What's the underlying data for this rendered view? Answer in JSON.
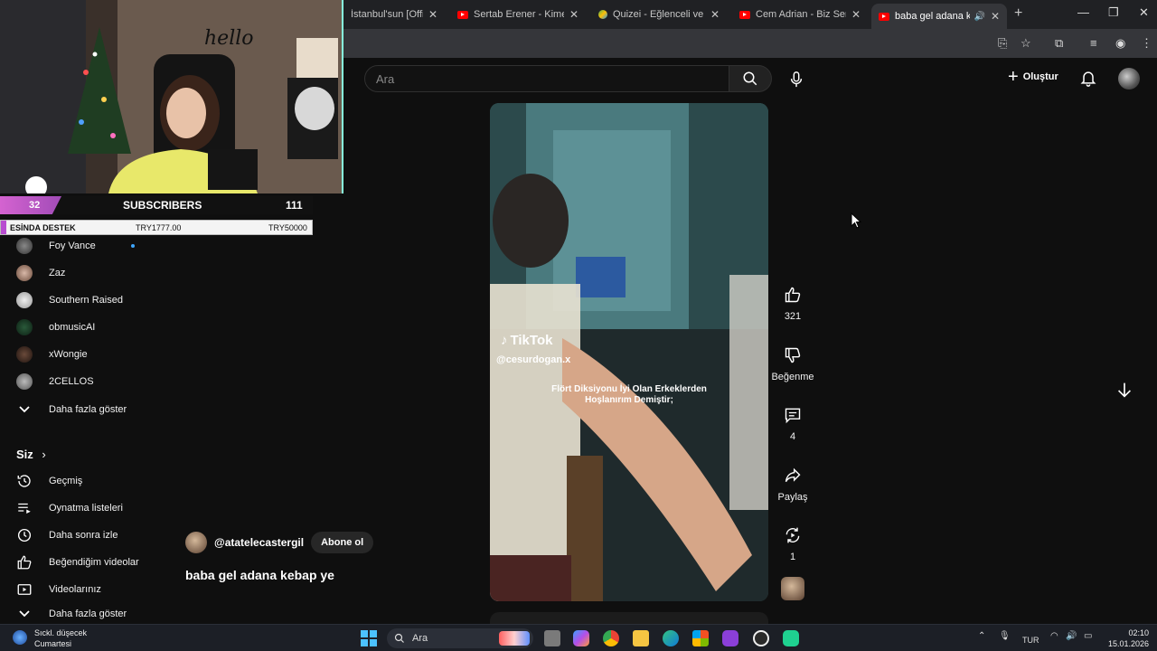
{
  "browser": {
    "tabs": [
      {
        "title": "İstanbul'sun [Official",
        "favicon": "youtube-icon"
      },
      {
        "title": "Sertab Erener - Kime Diye",
        "favicon": "youtube-icon"
      },
      {
        "title": "Quizei - Eğlenceli ve etki",
        "favicon": "quiz-icon"
      },
      {
        "title": "Cem Adrian - Biz Senle (",
        "favicon": "youtube-icon"
      },
      {
        "title": "baba gel adana kebap",
        "favicon": "youtube-icon",
        "active": true
      }
    ]
  },
  "youtube": {
    "search_placeholder": "Ara",
    "create_label": "Oluştur"
  },
  "stream_overlay": {
    "subscriber_count": "32",
    "subscribers_label": "SUBSCRIBERS",
    "subscribers_total": "111",
    "goal_label": "ESİNDA DESTEK",
    "goal_current": "TRY1777.00",
    "goal_target": "TRY50000",
    "webcam_text": "hello"
  },
  "sidebar": {
    "subscriptions": [
      {
        "label": "Foy Vance",
        "new": true
      },
      {
        "label": "Zaz"
      },
      {
        "label": "Southern Raised"
      },
      {
        "label": "obmusicAI"
      },
      {
        "label": "xWongie"
      },
      {
        "label": "2CELLOS"
      }
    ],
    "show_more_1": "Daha fazla göster",
    "you_title": "Siz",
    "you_items": [
      {
        "label": "Geçmiş",
        "icon": "history-icon"
      },
      {
        "label": "Oynatma listeleri",
        "icon": "playlist-icon"
      },
      {
        "label": "Daha sonra izle",
        "icon": "watch-later-icon"
      },
      {
        "label": "Beğendiğim videolar",
        "icon": "liked-icon"
      },
      {
        "label": "Videolarınız",
        "icon": "your-videos-icon"
      }
    ],
    "show_more_2": "Daha fazla göster"
  },
  "short": {
    "watermark_brand": "TikTok",
    "watermark_handle": "@cesurdogan.x",
    "caption_line1": "Flört Diksiyonu İyi Olan Erkeklerden",
    "caption_line2": "Hoşlanırım Demiştir;",
    "channel": "@atatelecastergil",
    "subscribe_label": "Abone ol",
    "title": "baba gel adana kebap ye",
    "likes": "321",
    "dislike_label": "Beğenme",
    "comments": "4",
    "share_label": "Paylaş",
    "remix": "1"
  },
  "taskbar": {
    "weather_title": "Sıckl. düşecek",
    "weather_sub": "Cumartesi",
    "search_label": "Ara",
    "language": "TUR",
    "time": "02:10",
    "date": "15.01.2026"
  }
}
